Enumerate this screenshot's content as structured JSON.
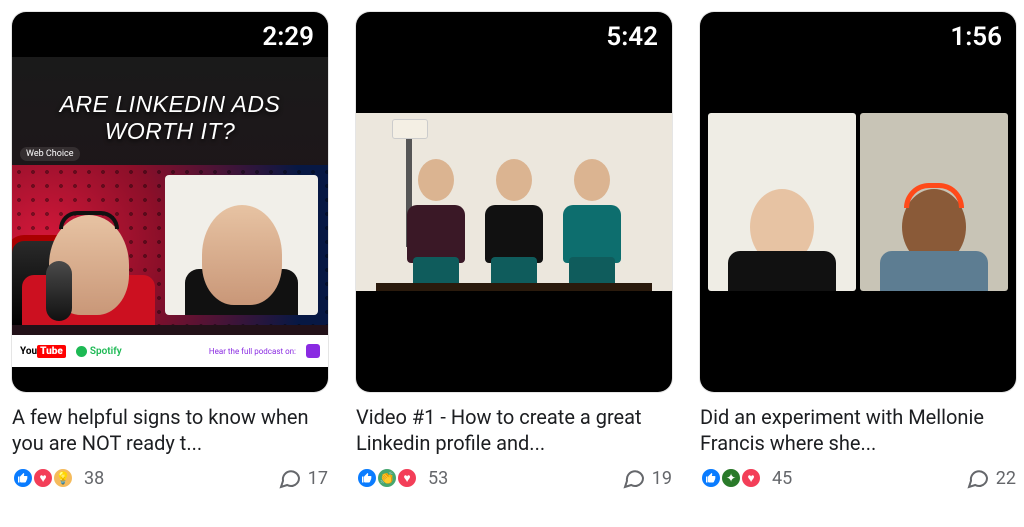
{
  "cards": [
    {
      "duration": "2:29",
      "thumb_headline": "ARE LINKEDIN ADS WORTH IT?",
      "thumb_tag": "Web Choice",
      "footer_youtube_a": "You",
      "footer_youtube_b": "Tube",
      "footer_spotify": "Spotify",
      "footer_hear": "Hear the full podcast on:",
      "title": "A few helpful signs to know when you are NOT ready t...",
      "reactions_count": "38",
      "comments": "17"
    },
    {
      "duration": "5:42",
      "title": "Video #1 - How to create a great Linkedin profile and...",
      "reactions_count": "53",
      "comments": "19"
    },
    {
      "duration": "1:56",
      "title": "Did an experiment with Mellonie Francis where she...",
      "reactions_count": "45",
      "comments": "22"
    }
  ]
}
